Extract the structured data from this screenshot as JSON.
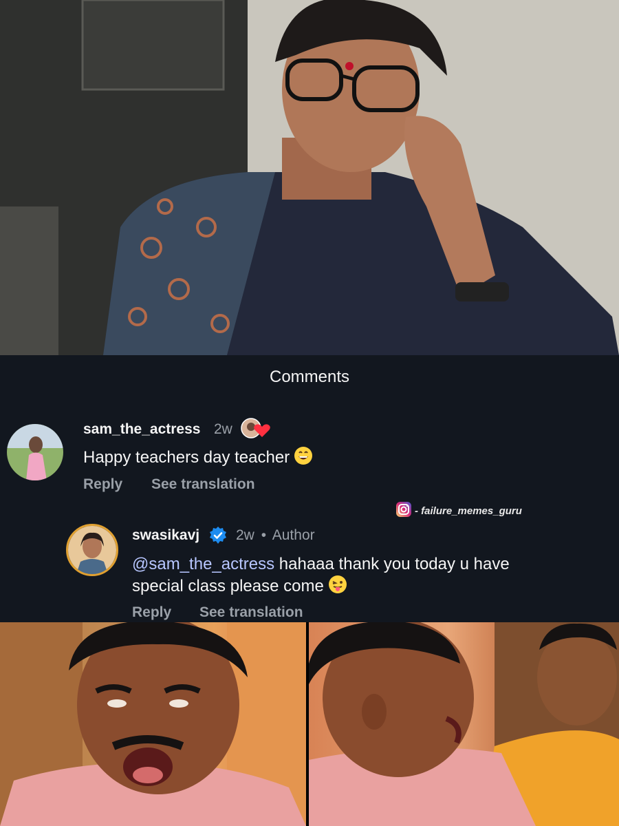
{
  "panel": {
    "title": "Comments"
  },
  "comment1": {
    "username": "sam_the_actress",
    "time": "2w",
    "text": "Happy teachers day teacher",
    "reply_label": "Reply",
    "translate_label": "See translation"
  },
  "watermark": {
    "text": "- failure_memes_guru"
  },
  "comment2": {
    "username": "swasikavj",
    "time": "2w",
    "separator": "•",
    "author_label": "Author",
    "mention": "@sam_the_actress",
    "text_line1": " hahaaa thank you today u have",
    "text_line2": "special class please come",
    "reply_label": "Reply",
    "translate_label": "See translation"
  },
  "colors": {
    "panel_bg": "#12171f",
    "verified": "#1d8cf0",
    "heart": "#ff3040",
    "mention": "#b7c6ff"
  },
  "icons": [
    "heart-liked-icon",
    "verified-badge-icon",
    "instagram-icon",
    "grin-emoji-icon",
    "tongue-emoji-icon"
  ]
}
